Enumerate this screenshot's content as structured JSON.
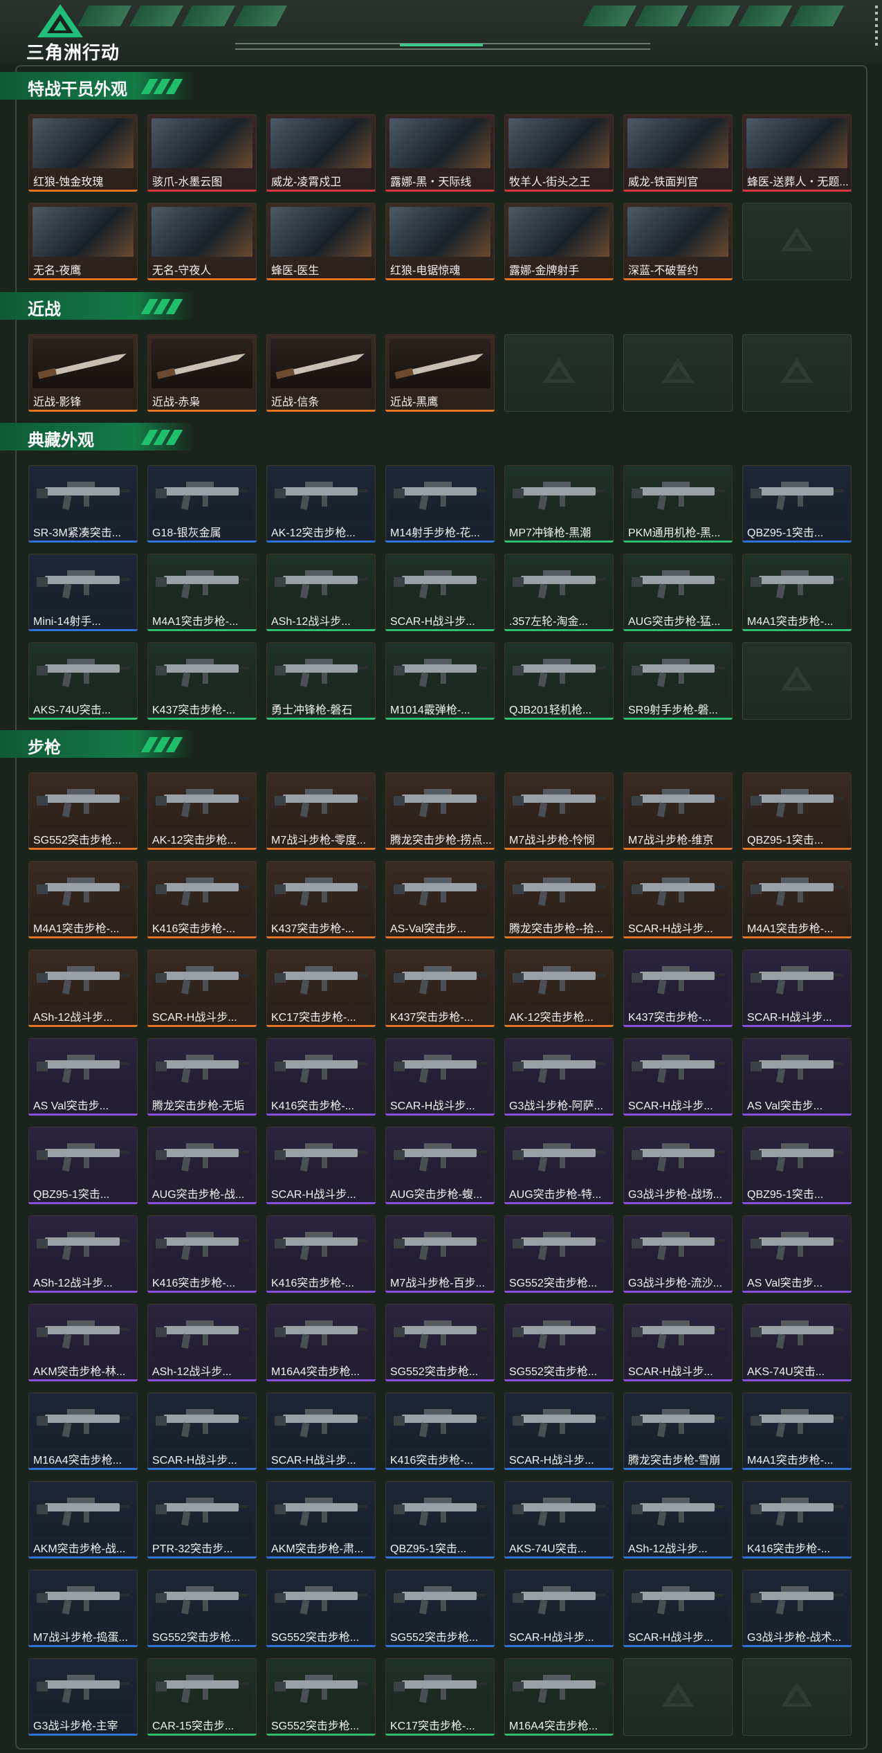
{
  "header": {
    "logo_text": "三角洲行动",
    "accent_color": "#3fc78a"
  },
  "sections": [
    {
      "title": "特战干员外观",
      "items": [
        {
          "label": "红狼-蚀金玫瑰",
          "rarity": "orange"
        },
        {
          "label": "骇爪-水墨云图",
          "rarity": "red"
        },
        {
          "label": "威龙-凌霄戍卫",
          "rarity": "red"
        },
        {
          "label": "露娜-黑・天际线",
          "rarity": "red"
        },
        {
          "label": "牧羊人-街头之王",
          "rarity": "red"
        },
        {
          "label": "威龙-铁面判官",
          "rarity": "red"
        },
        {
          "label": "蜂医-送葬人・无题...",
          "rarity": "red"
        },
        {
          "label": "无名-夜鹰",
          "rarity": "orange"
        },
        {
          "label": "无名-守夜人",
          "rarity": "orange"
        },
        {
          "label": "蜂医-医生",
          "rarity": "orange"
        },
        {
          "label": "红狼-电锯惊魂",
          "rarity": "orange"
        },
        {
          "label": "露娜-金牌射手",
          "rarity": "orange"
        },
        {
          "label": "深蓝-不破誓约",
          "rarity": "orange"
        },
        {
          "label": "",
          "rarity": "empty"
        }
      ]
    },
    {
      "title": "近战",
      "items": [
        {
          "label": "近战-影锋",
          "rarity": "orange"
        },
        {
          "label": "近战-赤枭",
          "rarity": "orange"
        },
        {
          "label": "近战-信条",
          "rarity": "orange"
        },
        {
          "label": "近战-黑鹰",
          "rarity": "orange"
        },
        {
          "label": "",
          "rarity": "empty"
        },
        {
          "label": "",
          "rarity": "empty"
        },
        {
          "label": "",
          "rarity": "empty"
        }
      ]
    },
    {
      "title": "典藏外观",
      "items": [
        {
          "label": "SR-3M紧凑突击...",
          "rarity": "blue"
        },
        {
          "label": "G18-银灰金属",
          "rarity": "blue"
        },
        {
          "label": "AK-12突击步枪...",
          "rarity": "blue"
        },
        {
          "label": "M14射手步枪-花...",
          "rarity": "blue"
        },
        {
          "label": "MP7冲锋枪-黑潮",
          "rarity": "green"
        },
        {
          "label": "PKM通用机枪-黑...",
          "rarity": "green"
        },
        {
          "label": "QBZ95-1突击...",
          "rarity": "blue"
        },
        {
          "label": "Mini-14射手...",
          "rarity": "blue"
        },
        {
          "label": "M4A1突击步枪-...",
          "rarity": "green"
        },
        {
          "label": "ASh-12战斗步...",
          "rarity": "green"
        },
        {
          "label": "SCAR-H战斗步...",
          "rarity": "green"
        },
        {
          "label": ".357左轮-淘金...",
          "rarity": "green"
        },
        {
          "label": "AUG突击步枪-猛...",
          "rarity": "green"
        },
        {
          "label": "M4A1突击步枪-...",
          "rarity": "green"
        },
        {
          "label": "AKS-74U突击...",
          "rarity": "green"
        },
        {
          "label": "K437突击步枪-...",
          "rarity": "green"
        },
        {
          "label": "勇士冲锋枪-磐石",
          "rarity": "green"
        },
        {
          "label": "M1014霰弹枪-...",
          "rarity": "green"
        },
        {
          "label": "QJB201轻机枪...",
          "rarity": "green"
        },
        {
          "label": "SR9射手步枪-磐...",
          "rarity": "green"
        },
        {
          "label": "",
          "rarity": "empty"
        }
      ]
    },
    {
      "title": "步枪",
      "items": [
        {
          "label": "SG552突击步枪...",
          "rarity": "orange"
        },
        {
          "label": "AK-12突击步枪...",
          "rarity": "orange"
        },
        {
          "label": "M7战斗步枪-零度...",
          "rarity": "orange"
        },
        {
          "label": "腾龙突击步枪-捞点...",
          "rarity": "orange"
        },
        {
          "label": "M7战斗步枪-怜悯",
          "rarity": "orange"
        },
        {
          "label": "M7战斗步枪-维京",
          "rarity": "orange"
        },
        {
          "label": "QBZ95-1突击...",
          "rarity": "orange"
        },
        {
          "label": "M4A1突击步枪-...",
          "rarity": "orange"
        },
        {
          "label": "K416突击步枪-...",
          "rarity": "orange"
        },
        {
          "label": "K437突击步枪-...",
          "rarity": "orange"
        },
        {
          "label": "AS-Val突击步...",
          "rarity": "orange"
        },
        {
          "label": "腾龙突击步枪--拾...",
          "rarity": "orange"
        },
        {
          "label": "SCAR-H战斗步...",
          "rarity": "orange"
        },
        {
          "label": "M4A1突击步枪-...",
          "rarity": "orange"
        },
        {
          "label": "ASh-12战斗步...",
          "rarity": "orange"
        },
        {
          "label": "SCAR-H战斗步...",
          "rarity": "orange"
        },
        {
          "label": "KC17突击步枪-...",
          "rarity": "orange"
        },
        {
          "label": "K437突击步枪-...",
          "rarity": "orange"
        },
        {
          "label": "AK-12突击步枪...",
          "rarity": "orange"
        },
        {
          "label": "K437突击步枪-...",
          "rarity": "purple"
        },
        {
          "label": "SCAR-H战斗步...",
          "rarity": "purple"
        },
        {
          "label": "AS Val突击步...",
          "rarity": "purple"
        },
        {
          "label": "腾龙突击步枪-无垢",
          "rarity": "purple"
        },
        {
          "label": "K416突击步枪-...",
          "rarity": "purple"
        },
        {
          "label": "SCAR-H战斗步...",
          "rarity": "purple"
        },
        {
          "label": "G3战斗步枪-阿萨...",
          "rarity": "purple"
        },
        {
          "label": "SCAR-H战斗步...",
          "rarity": "purple"
        },
        {
          "label": "AS Val突击步...",
          "rarity": "purple"
        },
        {
          "label": "QBZ95-1突击...",
          "rarity": "purple"
        },
        {
          "label": "AUG突击步枪-战...",
          "rarity": "purple"
        },
        {
          "label": "SCAR-H战斗步...",
          "rarity": "purple"
        },
        {
          "label": "AUG突击步枪-蝮...",
          "rarity": "purple"
        },
        {
          "label": "AUG突击步枪-特...",
          "rarity": "purple"
        },
        {
          "label": "G3战斗步枪-战场...",
          "rarity": "purple"
        },
        {
          "label": "QBZ95-1突击...",
          "rarity": "purple"
        },
        {
          "label": "ASh-12战斗步...",
          "rarity": "purple"
        },
        {
          "label": "K416突击步枪-...",
          "rarity": "purple"
        },
        {
          "label": "K416突击步枪-...",
          "rarity": "purple"
        },
        {
          "label": "M7战斗步枪-百步...",
          "rarity": "purple"
        },
        {
          "label": "SG552突击步枪...",
          "rarity": "purple"
        },
        {
          "label": "G3战斗步枪-流沙...",
          "rarity": "purple"
        },
        {
          "label": "AS Val突击步...",
          "rarity": "purple"
        },
        {
          "label": "AKM突击步枪-林...",
          "rarity": "purple"
        },
        {
          "label": "ASh-12战斗步...",
          "rarity": "purple"
        },
        {
          "label": "M16A4突击步枪...",
          "rarity": "purple"
        },
        {
          "label": "SG552突击步枪...",
          "rarity": "purple"
        },
        {
          "label": "SG552突击步枪...",
          "rarity": "purple"
        },
        {
          "label": "SCAR-H战斗步...",
          "rarity": "purple"
        },
        {
          "label": "AKS-74U突击...",
          "rarity": "purple"
        },
        {
          "label": "M16A4突击步枪...",
          "rarity": "blue"
        },
        {
          "label": "SCAR-H战斗步...",
          "rarity": "blue"
        },
        {
          "label": "SCAR-H战斗步...",
          "rarity": "blue"
        },
        {
          "label": "K416突击步枪-...",
          "rarity": "blue"
        },
        {
          "label": "SCAR-H战斗步...",
          "rarity": "blue"
        },
        {
          "label": "腾龙突击步枪-雪崩",
          "rarity": "blue"
        },
        {
          "label": "M4A1突击步枪-...",
          "rarity": "blue"
        },
        {
          "label": "AKM突击步枪-战...",
          "rarity": "blue"
        },
        {
          "label": "PTR-32突击步...",
          "rarity": "blue"
        },
        {
          "label": "AKM突击步枪-肃...",
          "rarity": "blue"
        },
        {
          "label": "QBZ95-1突击...",
          "rarity": "blue"
        },
        {
          "label": "AKS-74U突击...",
          "rarity": "blue"
        },
        {
          "label": "ASh-12战斗步...",
          "rarity": "blue"
        },
        {
          "label": "K416突击步枪-...",
          "rarity": "blue"
        },
        {
          "label": "M7战斗步枪-捣蛋...",
          "rarity": "blue"
        },
        {
          "label": "SG552突击步枪...",
          "rarity": "blue"
        },
        {
          "label": "SG552突击步枪...",
          "rarity": "blue"
        },
        {
          "label": "SG552突击步枪...",
          "rarity": "blue"
        },
        {
          "label": "SCAR-H战斗步...",
          "rarity": "blue"
        },
        {
          "label": "SCAR-H战斗步...",
          "rarity": "blue"
        },
        {
          "label": "G3战斗步枪-战术...",
          "rarity": "blue"
        },
        {
          "label": "G3战斗步枪-主宰",
          "rarity": "blue"
        },
        {
          "label": "CAR-15突击步...",
          "rarity": "green"
        },
        {
          "label": "SG552突击步枪...",
          "rarity": "green"
        },
        {
          "label": "KC17突击步枪-...",
          "rarity": "green"
        },
        {
          "label": "M16A4突击步枪...",
          "rarity": "green"
        },
        {
          "label": "",
          "rarity": "empty"
        },
        {
          "label": "",
          "rarity": "empty"
        }
      ]
    }
  ],
  "colors": {
    "orange": "#e2741f",
    "red": "#d7373c",
    "purple": "#8a4ee0",
    "blue": "#2e74d8",
    "green": "#2fbf6a"
  }
}
